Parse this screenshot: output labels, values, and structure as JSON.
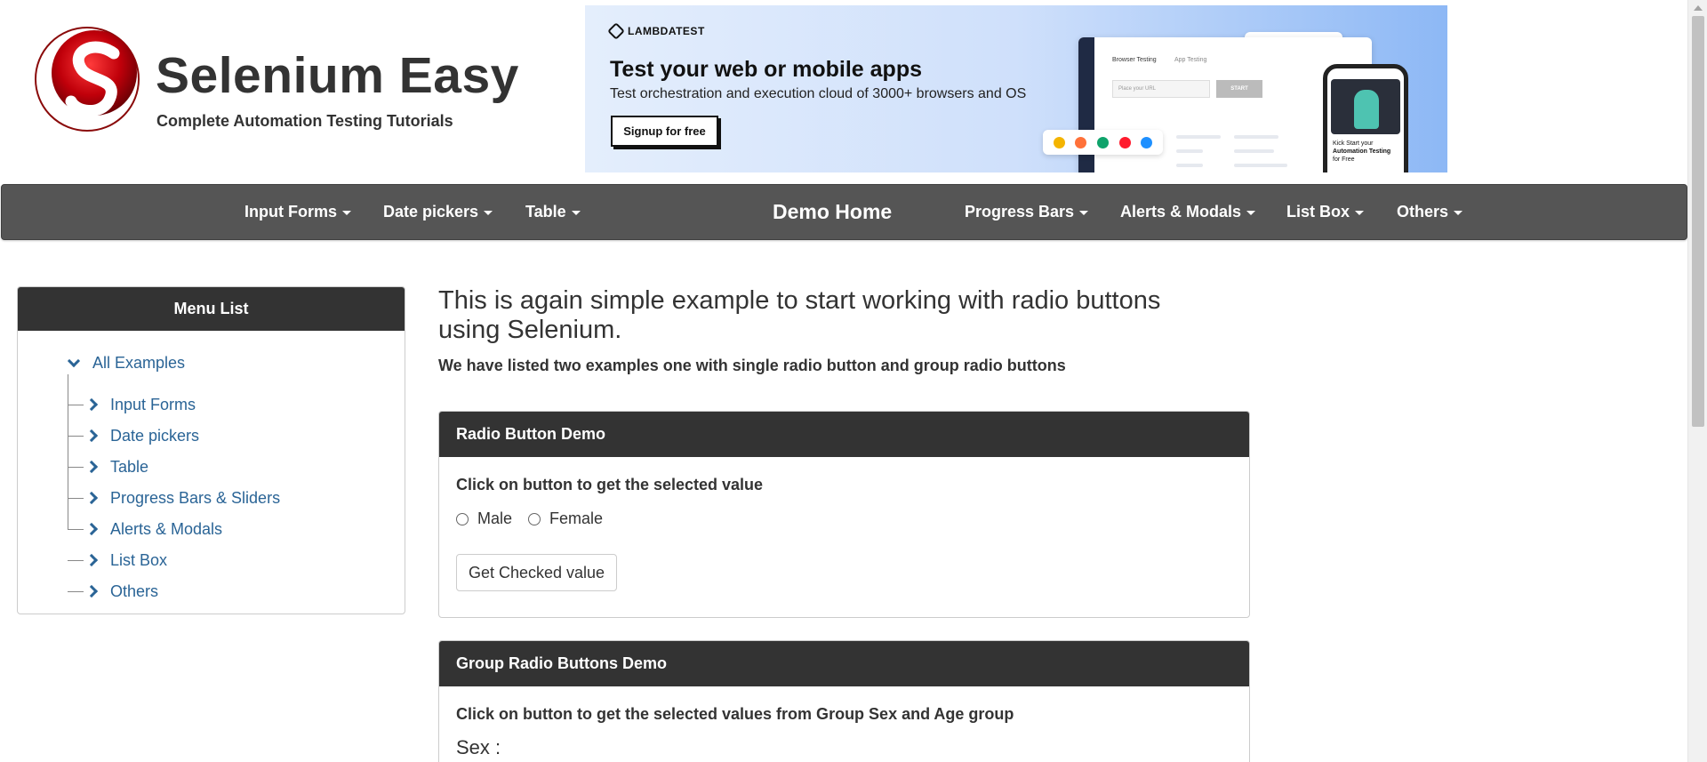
{
  "brand": {
    "title": "Selenium Easy",
    "subtitle": "Complete Automation Testing Tutorials"
  },
  "banner": {
    "logo_text": "LAMBDATEST",
    "title": "Test your web or mobile apps",
    "subtitle": "Test orchestration and execution cloud of 3000+ browsers and OS",
    "cta": "Signup for free",
    "mock_tab_1": "Browser Testing",
    "mock_tab_2": "App Testing",
    "mock_placeholder": "Place your URL",
    "mock_start": "START",
    "phone_text_1": "Kick Start your",
    "phone_text_2": "Automation Testing",
    "phone_text_3": "for Free"
  },
  "nav": {
    "items": [
      {
        "label": "Input Forms"
      },
      {
        "label": "Date pickers"
      },
      {
        "label": "Table"
      },
      {
        "label": "Demo Home"
      },
      {
        "label": "Progress Bars"
      },
      {
        "label": "Alerts & Modals"
      },
      {
        "label": "List Box"
      },
      {
        "label": "Others"
      }
    ]
  },
  "sidebar": {
    "title": "Menu List",
    "root": "All Examples",
    "items": [
      {
        "label": "Input Forms"
      },
      {
        "label": "Date pickers"
      },
      {
        "label": "Table"
      },
      {
        "label": "Progress Bars & Sliders"
      },
      {
        "label": "Alerts & Modals"
      },
      {
        "label": "List Box"
      },
      {
        "label": "Others"
      }
    ]
  },
  "main": {
    "heading": "This is again simple example to start working with radio buttons using Selenium.",
    "subheading": "We have listed two examples one with single radio button and group radio buttons",
    "radio_demo": {
      "title": "Radio Button Demo",
      "instruction": "Click on button to get the selected value",
      "options": [
        "Male",
        "Female"
      ],
      "button": "Get Checked value"
    },
    "group_demo": {
      "title": "Group Radio Buttons Demo",
      "instruction": "Click on button to get the selected values from Group Sex and Age group",
      "sex_label": "Sex :"
    }
  }
}
